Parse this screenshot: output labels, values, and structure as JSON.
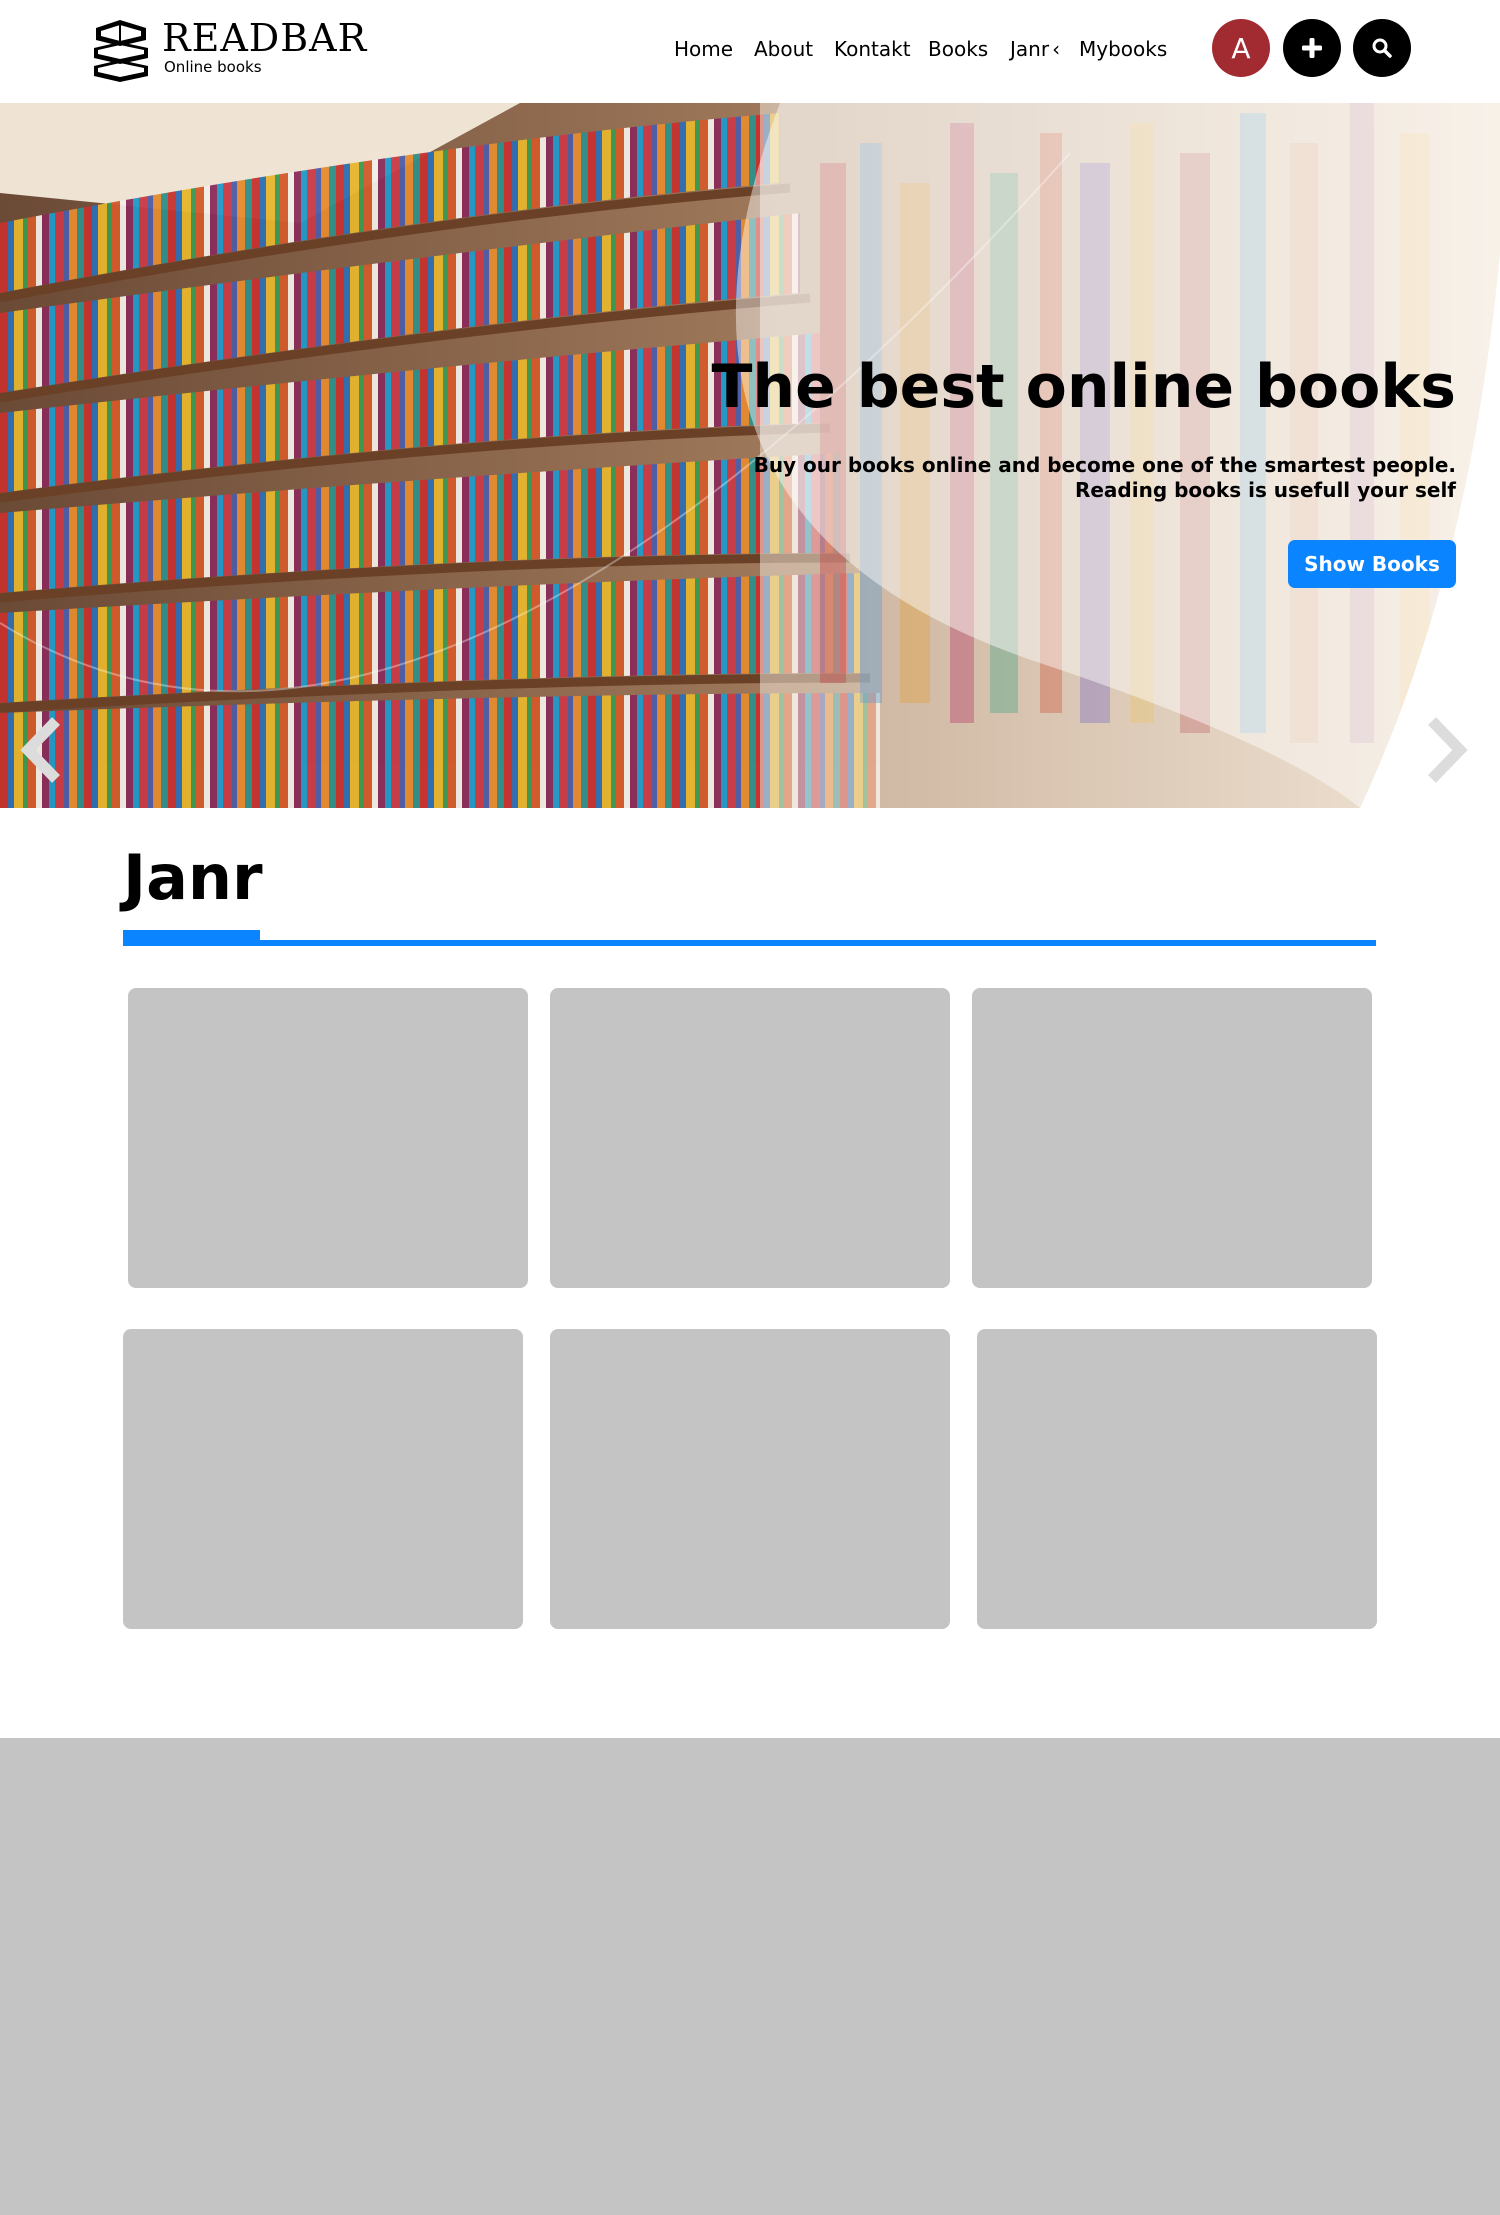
{
  "brand": {
    "name": "READBAR",
    "tagline": "Online books"
  },
  "nav": {
    "items": [
      {
        "label": "Home"
      },
      {
        "label": "About"
      },
      {
        "label": "Kontakt"
      },
      {
        "label": "Books"
      },
      {
        "label": "Janr",
        "icon": "chevron-left-icon"
      },
      {
        "label": "Mybooks"
      }
    ]
  },
  "header_actions": {
    "avatar_letter": "A",
    "avatar_color": "#a12b30",
    "add_icon": "plus-icon",
    "search_icon": "search-icon"
  },
  "hero": {
    "title": "The best online books",
    "subtitle_line1": "Buy our books online and become one of the smartest people.",
    "subtitle_line2": "Reading books is usefull your self",
    "button_label": "Show Books",
    "accent_color": "#0a84ff",
    "prev_icon": "chevron-left-icon",
    "next_icon": "chevron-right-icon"
  },
  "section": {
    "title": "Janr",
    "cards": [
      {
        "label": ""
      },
      {
        "label": ""
      },
      {
        "label": ""
      },
      {
        "label": ""
      },
      {
        "label": ""
      },
      {
        "label": ""
      }
    ]
  },
  "colors": {
    "accent": "#0a84ff",
    "placeholder": "#c4c4c4",
    "avatar": "#a12b30"
  }
}
